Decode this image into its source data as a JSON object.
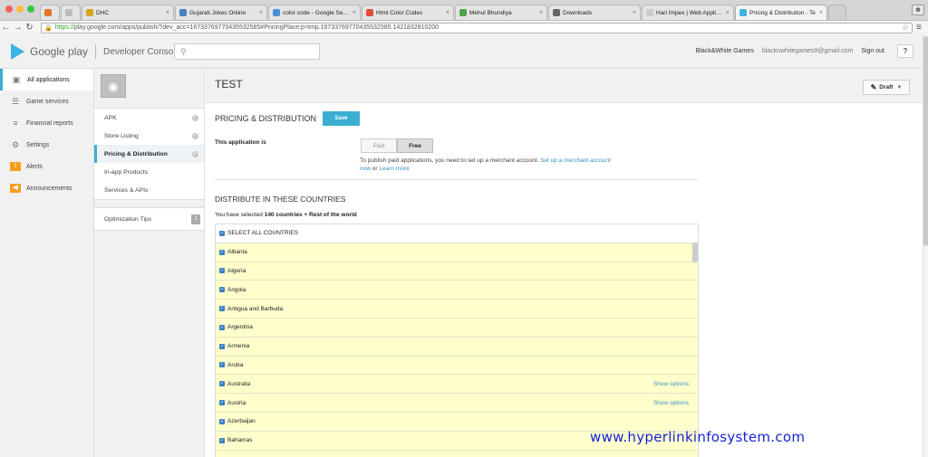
{
  "browser": {
    "tabs": [
      {
        "label": "",
        "icon": "page-icon",
        "color": "#e2742c"
      },
      {
        "label": "",
        "icon": "blank-page-icon",
        "color": "#bbbbbb"
      },
      {
        "label": "DHC",
        "icon": "dhc-icon",
        "color": "#d9a31c"
      },
      {
        "label": "Gujarati Jokes Online",
        "icon": "gujarati-icon",
        "color": "#4a7fc1"
      },
      {
        "label": "color code - Google Searc",
        "icon": "google-icon",
        "color": "#4a90d9"
      },
      {
        "label": "Html Color Codes",
        "icon": "colors-icon",
        "color": "#e24c3c"
      },
      {
        "label": "Mehul Bhundiya",
        "icon": "chart-icon",
        "color": "#4aa34a"
      },
      {
        "label": "Downloads",
        "icon": "download-icon",
        "color": "#666666"
      },
      {
        "label": "Hari Impex | Web Applicati",
        "icon": "page-icon",
        "color": "#cccccc"
      },
      {
        "label": "Pricing & Distribution - Te",
        "icon": "play-icon",
        "color": "#3bb3e5"
      }
    ],
    "url_secure": "https://",
    "url": "play.google.com/apps/publish/?dev_acc=16733769770435532585#PricingPlace:p=tmp.16733769770435532585.1421832810200"
  },
  "header": {
    "brand": "Google play",
    "console": "Developer Console",
    "search_placeholder": "",
    "account_name": "Black&White Games",
    "account_email": "blacknwhitegames9@gmail.com",
    "sign_out": "Sign out",
    "help": "?"
  },
  "leftnav": [
    {
      "label": "All applications",
      "icon": "android-icon",
      "active": true
    },
    {
      "label": "Game services",
      "icon": "gamepad-icon"
    },
    {
      "label": "Financial reports",
      "icon": "financial-icon"
    },
    {
      "label": "Settings",
      "icon": "gear-icon"
    },
    {
      "label": "Alerts",
      "icon": "alert-icon"
    },
    {
      "label": "Announcements",
      "icon": "megaphone-icon"
    }
  ],
  "app_menu": [
    {
      "label": "APK",
      "checked": true
    },
    {
      "label": "Store Listing",
      "checked": true
    },
    {
      "label": "Pricing & Distribution",
      "checked": true,
      "active": true
    },
    {
      "label": "In-app Products",
      "checked": false
    },
    {
      "label": "Services & APIs",
      "checked": false
    }
  ],
  "optimization": {
    "label": "Optimization Tips",
    "count": "1"
  },
  "main": {
    "app_title": "TEST",
    "draft_label": "Draft",
    "section_title": "PRICING & DISTRIBUTION",
    "save_label": "Save",
    "application_label": "This application is",
    "paid_label": "Paid",
    "free_label": "Free",
    "paid_note_pre": "To publish paid applications, you need to set up a merchant account.",
    "paid_note_link": "Set up a merchant account now",
    "paid_note_or": "or",
    "paid_note_learn": "Learn more",
    "distribute_title": "DISTRIBUTE IN THESE COUNTRIES",
    "selected_pre": "You have selected",
    "selected_bold": "140 countries + Rest of the world",
    "select_all": "SELECT ALL COUNTRIES",
    "countries": [
      {
        "name": "Albania",
        "options": ""
      },
      {
        "name": "Algeria",
        "options": ""
      },
      {
        "name": "Angola",
        "options": ""
      },
      {
        "name": "Antigua and Barbuda",
        "options": ""
      },
      {
        "name": "Argentina",
        "options": ""
      },
      {
        "name": "Armenia",
        "options": ""
      },
      {
        "name": "Aruba",
        "options": ""
      },
      {
        "name": "Australia",
        "options": "Show options"
      },
      {
        "name": "Austria",
        "options": "Show options"
      },
      {
        "name": "Azerbaijan",
        "options": ""
      },
      {
        "name": "Bahamas",
        "options": ""
      },
      {
        "name": "",
        "options": ""
      }
    ]
  },
  "watermark": "www.hyperlinkinfosystem.com"
}
